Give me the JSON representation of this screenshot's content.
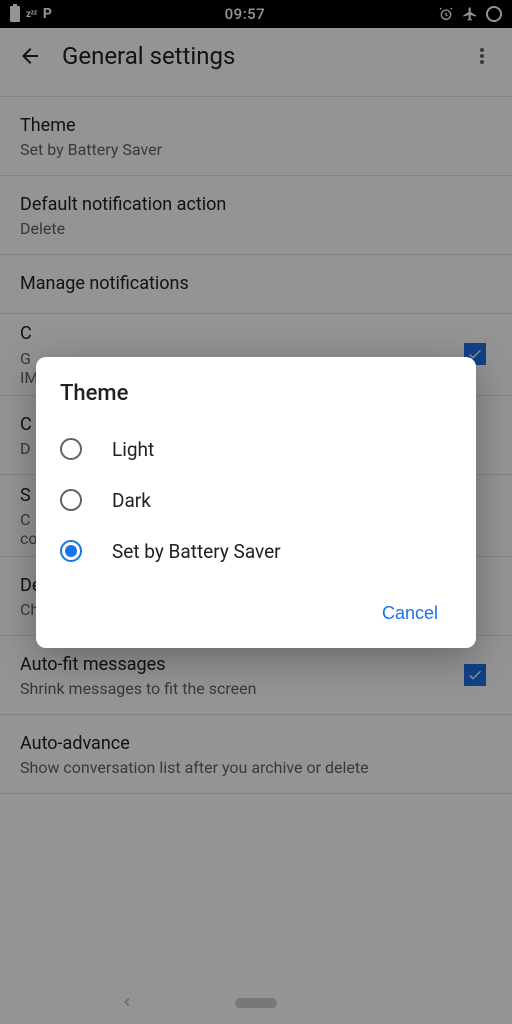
{
  "status": {
    "time": "09:57",
    "zzz": "zᶻᶻ",
    "p": "P"
  },
  "appbar": {
    "title": "General settings"
  },
  "settings": [
    {
      "title": "Theme",
      "sub": "Set by Battery Saver",
      "checkbox": false,
      "checked": false
    },
    {
      "title": "Default notification action",
      "sub": "Delete",
      "checkbox": false,
      "checked": false
    },
    {
      "title": "Manage notifications",
      "sub": "",
      "checkbox": false,
      "checked": false
    },
    {
      "title": "C",
      "sub": "G\nIM",
      "checkbox": true,
      "checked": true,
      "obscured": true
    },
    {
      "title": "C",
      "sub": "D",
      "checkbox": false,
      "checked": false,
      "obscured": true
    },
    {
      "title": "S",
      "sub": "C\nco",
      "checkbox": false,
      "checked": false,
      "obscured": true
    },
    {
      "title": "Default reply action",
      "sub": "Choose your default reply action",
      "checkbox": false,
      "checked": false
    },
    {
      "title": "Auto-fit messages",
      "sub": "Shrink messages to fit the screen",
      "checkbox": true,
      "checked": true
    },
    {
      "title": "Auto-advance",
      "sub": "Show conversation list after you archive or delete",
      "checkbox": false,
      "checked": false
    }
  ],
  "dialog": {
    "title": "Theme",
    "options": [
      {
        "label": "Light",
        "selected": false
      },
      {
        "label": "Dark",
        "selected": false
      },
      {
        "label": "Set by Battery Saver",
        "selected": true
      }
    ],
    "cancel": "Cancel"
  }
}
